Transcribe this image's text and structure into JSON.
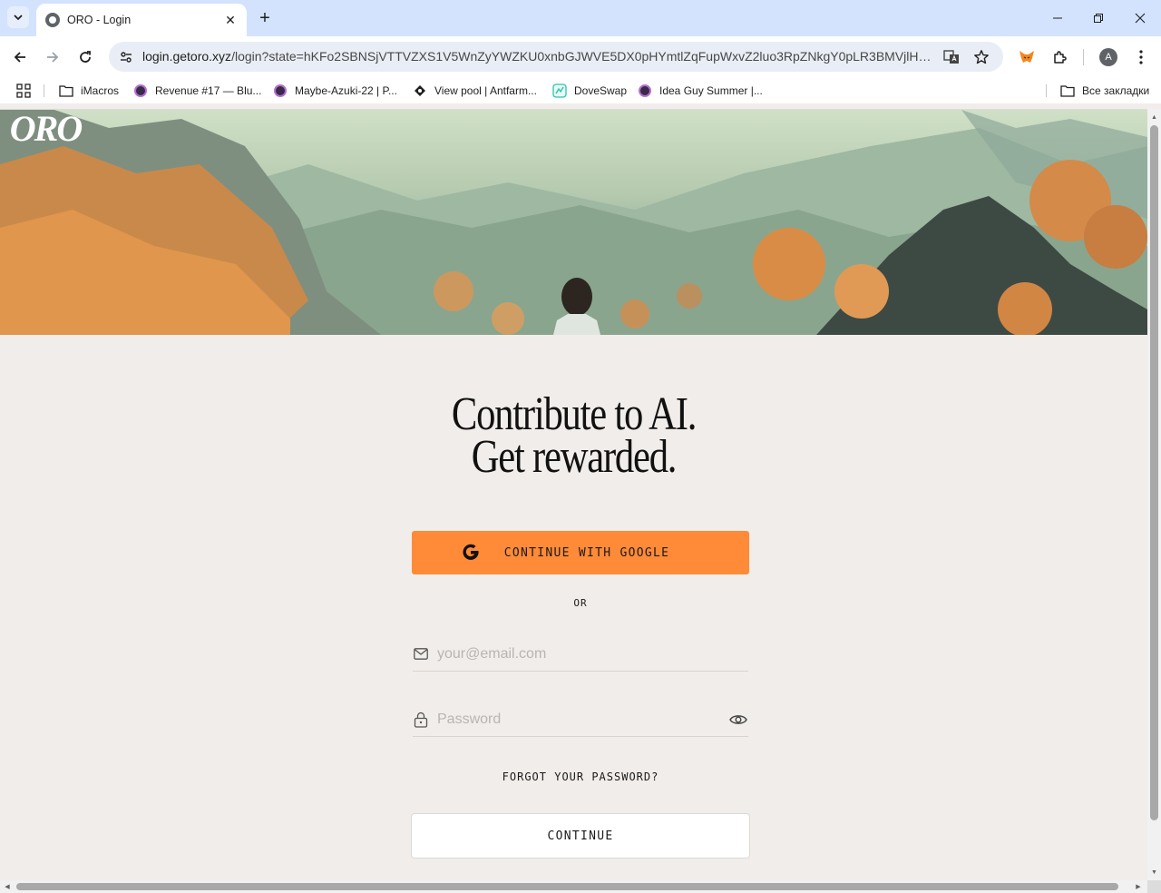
{
  "browser": {
    "tab": {
      "title": "ORO - Login",
      "favicon": "globe-icon",
      "close_glyph": "✕"
    },
    "new_tab_glyph": "+",
    "url_host": "login.getoro.xyz",
    "url_path": "/login?state=hKFo2SBNSjVTTVZXS1V5WnZyYWZKU0xnbGJWVE5DX0pHYmtlZqFupWxvZ2luo3RpZNkgY0pLR3BMVjlHX0hX...",
    "profile_initial": "A",
    "bookmarks": [
      {
        "label": "iMacros",
        "icon": "folder-icon"
      },
      {
        "label": "Revenue #17 — Blu...",
        "icon": "avatar-icon"
      },
      {
        "label": "Maybe-Azuki-22 | P...",
        "icon": "avatar-icon"
      },
      {
        "label": "View pool | Antfarm...",
        "icon": "antfarm-icon"
      },
      {
        "label": "DoveSwap",
        "icon": "doveswap-icon"
      },
      {
        "label": "Idea Guy Summer |...",
        "icon": "avatar-icon"
      }
    ],
    "all_bookmarks_label": "Все закладки"
  },
  "page": {
    "logo_text": "ORO",
    "headline_line1": "Contribute to AI.",
    "headline_line2": "Get rewarded.",
    "google_button_label": "CONTINUE WITH GOOGLE",
    "or_label": "OR",
    "email_placeholder": "your@email.com",
    "password_placeholder": "Password",
    "forgot_label": "FORGOT YOUR PASSWORD?",
    "continue_label": "CONTINUE"
  },
  "colors": {
    "accent": "#ff8a38",
    "page_bg": "#f1edea",
    "tabstrip_bg": "#d3e3fd"
  }
}
